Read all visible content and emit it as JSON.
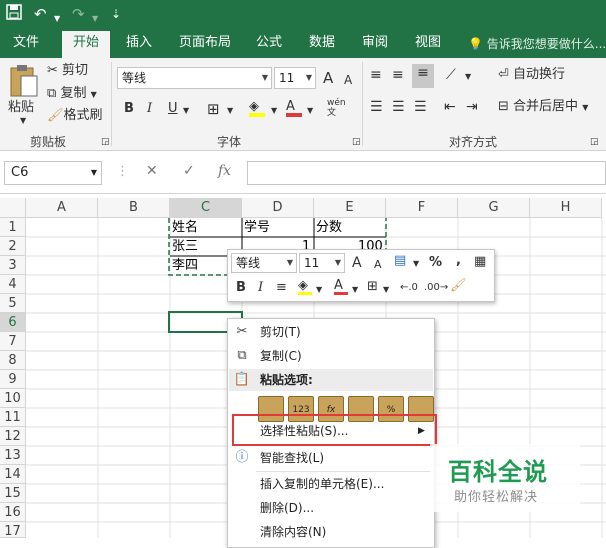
{
  "qat": {
    "save_icon": "save-icon",
    "undo_glyph": "↶",
    "redo_glyph": "↷",
    "customize_glyph": "⇣"
  },
  "tabs": [
    {
      "label": "文件"
    },
    {
      "label": "开始"
    },
    {
      "label": "插入"
    },
    {
      "label": "页面布局"
    },
    {
      "label": "公式"
    },
    {
      "label": "数据"
    },
    {
      "label": "审阅"
    },
    {
      "label": "视图"
    }
  ],
  "tell_me": "告诉我您想要做什么...",
  "ribbon": {
    "paste_label": "粘贴",
    "cut_label": "剪切",
    "copy_label": "复制",
    "format_painter_label": "格式刷",
    "clipboard_group": "剪贴板",
    "font_name": "等线",
    "font_size": "11",
    "grow_font": "A",
    "shrink_font": "A",
    "bold": "B",
    "italic": "I",
    "underline": "U",
    "phonetic": "wén",
    "font_color_letter": "A",
    "font_group": "字体",
    "wrap_text": "自动换行",
    "merge_center": "合并后居中",
    "alignment_group": "对齐方式"
  },
  "formula_bar": {
    "name_box": "C6",
    "cancel": "✕",
    "enter": "✓",
    "fx": "fx",
    "value": ""
  },
  "columns": [
    "A",
    "B",
    "C",
    "D",
    "E",
    "F",
    "G",
    "H"
  ],
  "rows": [
    "1",
    "2",
    "3",
    "4",
    "5",
    "6",
    "7",
    "8",
    "9",
    "10",
    "11",
    "12",
    "13",
    "14",
    "15",
    "16",
    "17"
  ],
  "cells": {
    "c1": "姓名",
    "d1": "学号",
    "e1": "分数",
    "c2": "张三",
    "d2": "1",
    "e2": "100",
    "c3": "李四"
  },
  "mini_toolbar": {
    "font": "等线",
    "size": "11",
    "grow": "A",
    "shrink": "A",
    "percent": "%",
    "comma": ",",
    "bold": "B",
    "italic": "I",
    "font_color": "A"
  },
  "context_menu": {
    "cut": "剪切(T)",
    "copy": "复制(C)",
    "paste_options": "粘贴选项:",
    "paste_icons": [
      "",
      "123",
      "fx",
      "",
      "",
      " %"
    ],
    "paste_special": "选择性粘贴(S)...",
    "smart_lookup": "智能查找(L)",
    "insert_copied": "插入复制的单元格(E)...",
    "delete": "删除(D)...",
    "clear": "清除内容(N)"
  },
  "watermark": {
    "title": "百科全说",
    "subtitle": "助你轻松解决"
  },
  "colors": {
    "excel_green": "#217346",
    "highlight_red": "#e03a3a",
    "selection_green": "#217346"
  }
}
